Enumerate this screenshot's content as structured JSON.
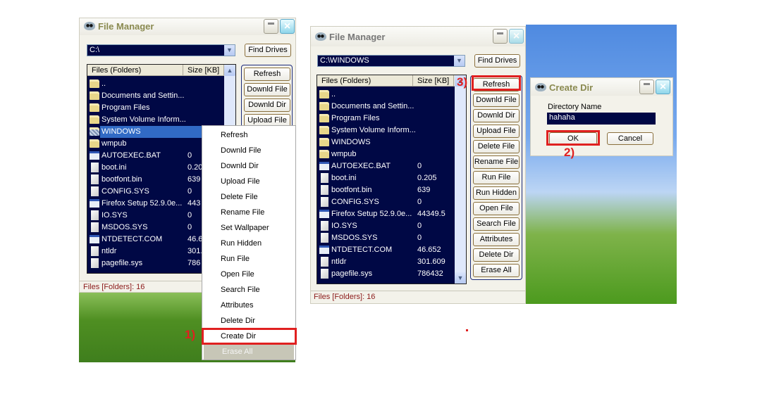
{
  "left_window": {
    "title": "File Manager",
    "path": "C:\\",
    "find_drives": "Find Drives",
    "columns": [
      "Files (Folders)",
      "Size [KB]"
    ],
    "rows": [
      {
        "name": "..",
        "size": "",
        "icon": "folder-icon"
      },
      {
        "name": "Documents and Settin...",
        "size": "",
        "icon": "folder-icon"
      },
      {
        "name": "Program Files",
        "size": "",
        "icon": "folder-icon"
      },
      {
        "name": "System Volume Inform...",
        "size": "",
        "icon": "folder-icon"
      },
      {
        "name": "WINDOWS",
        "size": "",
        "icon": "folder-icon",
        "selected": true
      },
      {
        "name": "wmpub",
        "size": "",
        "icon": "folder-icon"
      },
      {
        "name": "AUTOEXEC.BAT",
        "size": "0",
        "icon": "exe-icon"
      },
      {
        "name": "boot.ini",
        "size": "0.20",
        "icon": "file-icon"
      },
      {
        "name": "bootfont.bin",
        "size": "639",
        "icon": "file-icon"
      },
      {
        "name": "CONFIG.SYS",
        "size": "0",
        "icon": "file-icon"
      },
      {
        "name": "Firefox Setup 52.9.0e...",
        "size": "443",
        "icon": "exe-icon"
      },
      {
        "name": "IO.SYS",
        "size": "0",
        "icon": "file-icon"
      },
      {
        "name": "MSDOS.SYS",
        "size": "0",
        "icon": "file-icon"
      },
      {
        "name": "NTDETECT.COM",
        "size": "46.6",
        "icon": "exe-icon"
      },
      {
        "name": "ntldr",
        "size": "301.",
        "icon": "file-icon"
      },
      {
        "name": "pagefile.sys",
        "size": "786",
        "icon": "file-icon"
      }
    ],
    "buttons": [
      "Refresh",
      "Downld File",
      "Downld Dir",
      "Upload File"
    ],
    "status": "Files [Folders]: 16",
    "context_menu": [
      "Refresh",
      "Downld File",
      "Downld Dir",
      "Upload File",
      "Delete File",
      "Rename File",
      "Set Wallpaper",
      "Run Hidden",
      "Run File",
      "Open File",
      "Search File",
      "Attributes",
      "Delete Dir",
      "Create Dir",
      "Erase All"
    ],
    "context_menu_disabled": "Erase All",
    "step_label": "1)"
  },
  "right_window": {
    "title": "File Manager",
    "path": "C:\\WINDOWS",
    "find_drives": "Find Drives",
    "columns": [
      "Files (Folders)",
      "Size [KB]"
    ],
    "rows": [
      {
        "name": "..",
        "size": "",
        "icon": "folder-icon"
      },
      {
        "name": "Documents and Settin...",
        "size": "",
        "icon": "folder-icon"
      },
      {
        "name": "Program Files",
        "size": "",
        "icon": "folder-icon"
      },
      {
        "name": "System Volume Inform...",
        "size": "",
        "icon": "folder-icon"
      },
      {
        "name": "WINDOWS",
        "size": "",
        "icon": "folder-icon"
      },
      {
        "name": "wmpub",
        "size": "",
        "icon": "folder-icon"
      },
      {
        "name": "AUTOEXEC.BAT",
        "size": "0",
        "icon": "exe-icon"
      },
      {
        "name": "boot.ini",
        "size": "0.205",
        "icon": "file-icon"
      },
      {
        "name": "bootfont.bin",
        "size": "639",
        "icon": "file-icon"
      },
      {
        "name": "CONFIG.SYS",
        "size": "0",
        "icon": "file-icon"
      },
      {
        "name": "Firefox Setup 52.9.0e...",
        "size": "44349.5",
        "icon": "exe-icon"
      },
      {
        "name": "IO.SYS",
        "size": "0",
        "icon": "file-icon"
      },
      {
        "name": "MSDOS.SYS",
        "size": "0",
        "icon": "file-icon"
      },
      {
        "name": "NTDETECT.COM",
        "size": "46.652",
        "icon": "exe-icon"
      },
      {
        "name": "ntldr",
        "size": "301.609",
        "icon": "file-icon"
      },
      {
        "name": "pagefile.sys",
        "size": "786432",
        "icon": "file-icon"
      }
    ],
    "buttons": [
      "Refresh",
      "Downld File",
      "Downld Dir",
      "Upload File",
      "Delete File",
      "Rename File",
      "Run File",
      "Run Hidden",
      "Open File",
      "Search File",
      "Attributes",
      "Delete Dir",
      "Erase All"
    ],
    "status": "Files [Folders]: 16",
    "step_label": "3)"
  },
  "dialog": {
    "title": "Create Dir",
    "label": "Directory Name",
    "value": "hahaha",
    "ok": "OK",
    "cancel": "Cancel",
    "step_label": "2)"
  },
  "colors": {
    "accent_red": "#e02020",
    "list_bg": "#000845",
    "selection": "#316ac5",
    "status_text": "#8b1a1a"
  }
}
